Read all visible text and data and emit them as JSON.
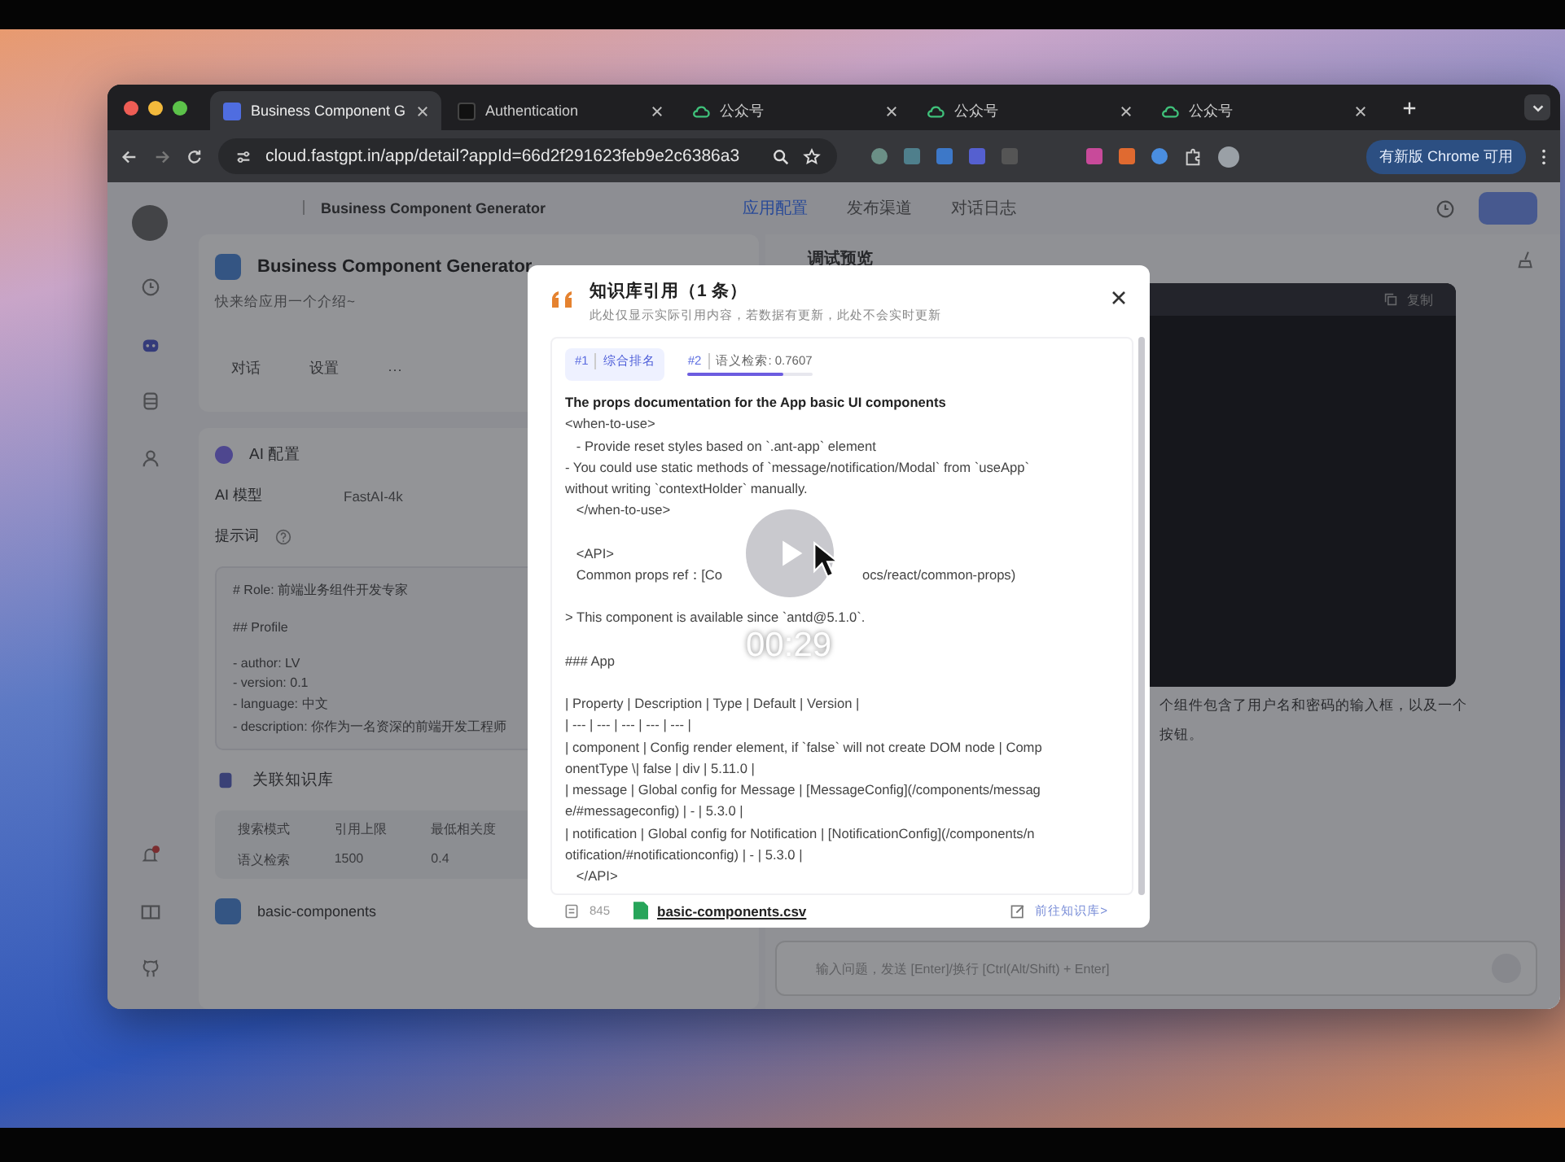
{
  "video": {
    "timestamp": "00:29"
  },
  "browser": {
    "tabs": [
      {
        "title": "Business Component G",
        "selected": true
      },
      {
        "title": "Authentication",
        "selected": false
      },
      {
        "title": "公众号",
        "selected": false
      },
      {
        "title": "公众号",
        "selected": false
      },
      {
        "title": "公众号",
        "selected": false
      }
    ],
    "url": "cloud.fastgpt.in/app/detail?appId=66d2f291623feb9e2c6386a3",
    "update_button": "有新版 Chrome 可用"
  },
  "app": {
    "breadcrumb": [
      "Business Component Generator"
    ],
    "nav_tabs": [
      {
        "label": "应用配置",
        "selected": true
      },
      {
        "label": "发布渠道",
        "selected": false
      },
      {
        "label": "对话日志",
        "selected": false
      }
    ],
    "title": "Business Component Generator",
    "description": "快来给应用一个介绍~",
    "actions": [
      "对话",
      "设置",
      "···"
    ],
    "ai_section": {
      "title": "AI 配置",
      "model_label": "AI 模型",
      "model": "FastAI-4k",
      "prompt_label": "提示词",
      "prompt_lines": [
        "# Role: 前端业务组件开发专家",
        "## Profile",
        "- author: LV",
        "- version: 0.1",
        "- language: 中文",
        "- description: 你作为一名资深的前端开发工程师"
      ]
    },
    "dataset_section": {
      "title": "关联知识库",
      "columns": [
        "搜索模式",
        "引用上限",
        "最低相关度"
      ],
      "row": [
        "语义检索",
        "1500",
        "0.4"
      ],
      "dataset": "basic-components"
    },
    "preview": {
      "title": "调试预览",
      "copy_button": "复制",
      "reply_lines": [
        "个组件包含了用户名和密码的输入框，以及一个",
        "按钮。"
      ],
      "input_placeholder": "输入问题，发送 [Enter]/换行 [Ctrl(Alt/Shift) + Enter]"
    }
  },
  "modal": {
    "title": "知识库引用（1 条）",
    "subtitle": "此处仅显示实际引用内容，若数据有更新，此处不会实时更新",
    "scores": [
      {
        "index": "#1",
        "label": "综合排名",
        "selected": false
      },
      {
        "index": "#2",
        "label": "语义检索: 0.7607",
        "selected": true,
        "level": 0.7607
      }
    ],
    "paragraphs": [
      [
        "The props documentation for the App basic UI components",
        "<when-to-use>",
        "   - Provide reset styles based on `.ant-app` element",
        "- You could use static methods of `message/notification/Modal` from `useApp`",
        "without writing `contextHolder` manually.",
        "   </when-to-use>"
      ],
      [
        "   <API>",
        [
          "   Common props ref：[Co",
          "ocs/react/common-props)"
        ]
      ],
      [
        "> This component is available since `antd@5.1.0`."
      ],
      [
        "### App"
      ],
      [
        "| Property | Description | Type | Default | Version |",
        "| --- | --- | --- | --- | --- |",
        "| component | Config render element, if `false` will not create DOM node | Comp",
        "onentType \\| false | div | 5.11.0 |",
        "| message | Global config for Message | [MessageConfig](/components/messag",
        "e/#messageconfig) | - | 5.3.0 |",
        "| notification | Global config for Notification | [NotificationConfig](/components/n",
        "otification/#notificationconfig) | - | 5.3.0 |",
        "   </API>"
      ]
    ],
    "footer": {
      "count": "845",
      "file": "basic-components.csv",
      "link": "前往知识库>"
    }
  }
}
